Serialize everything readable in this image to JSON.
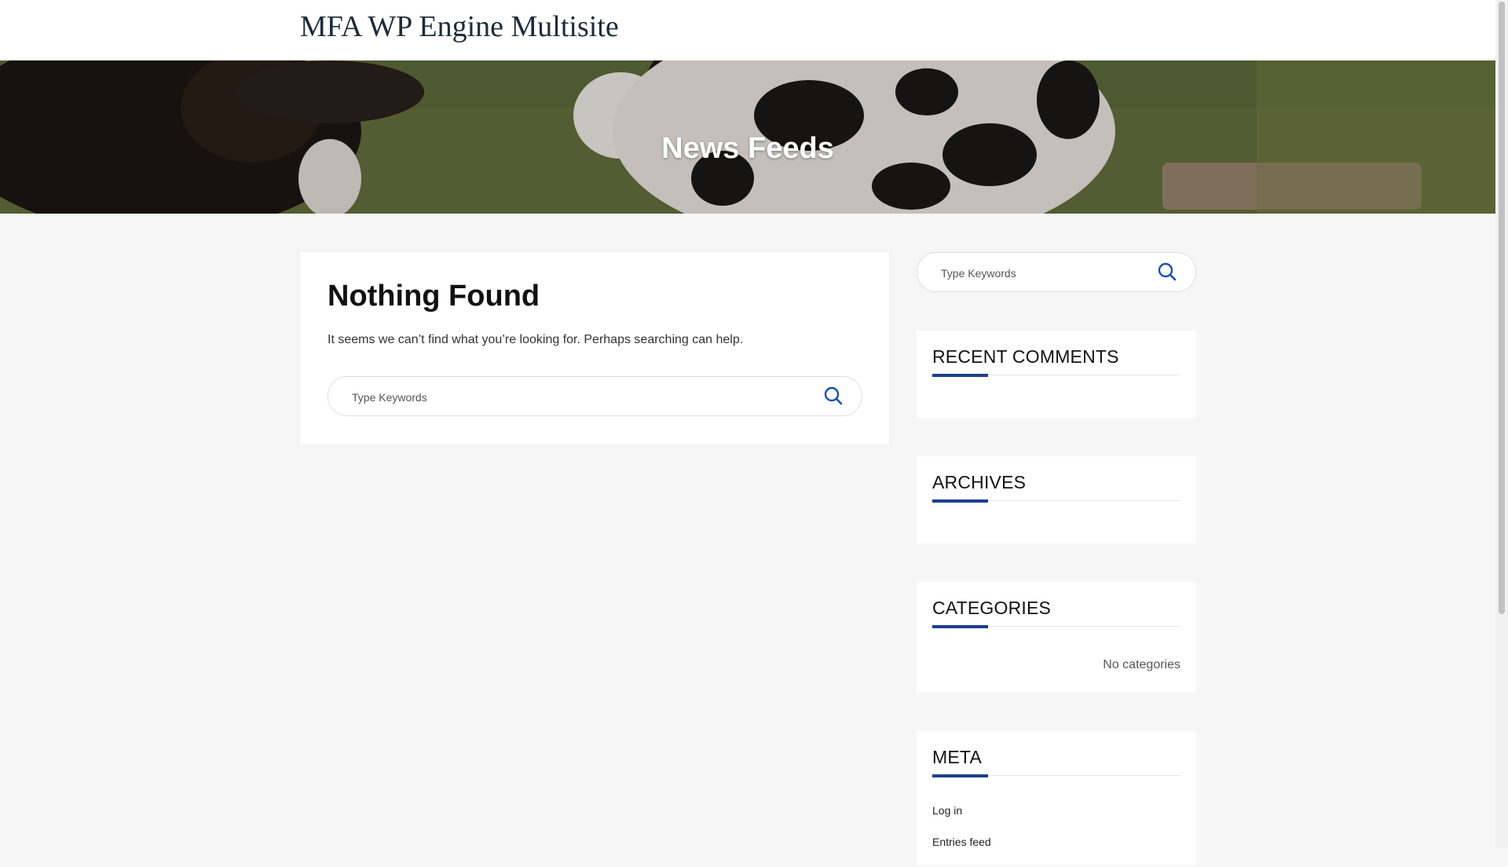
{
  "header": {
    "site_title": "MFA WP Engine Multisite"
  },
  "hero": {
    "title": "News Feeds"
  },
  "main": {
    "title": "Nothing Found",
    "message": "It seems we can’t find what you’re looking for. Perhaps searching can help.",
    "search": {
      "placeholder": "Type Keywords",
      "icon": "search-icon"
    }
  },
  "sidebar": {
    "search": {
      "placeholder": "Type Keywords",
      "icon": "search-icon"
    },
    "recent_comments": {
      "title": "RECENT COMMENTS"
    },
    "archives": {
      "title": "ARCHIVES"
    },
    "categories": {
      "title": "CATEGORIES",
      "empty_text": "No categories"
    },
    "meta": {
      "title": "META",
      "links": [
        "Log in",
        "Entries feed"
      ]
    }
  },
  "colors": {
    "accent": "#1b3f8f",
    "search_icon": "#1b4fb0"
  }
}
